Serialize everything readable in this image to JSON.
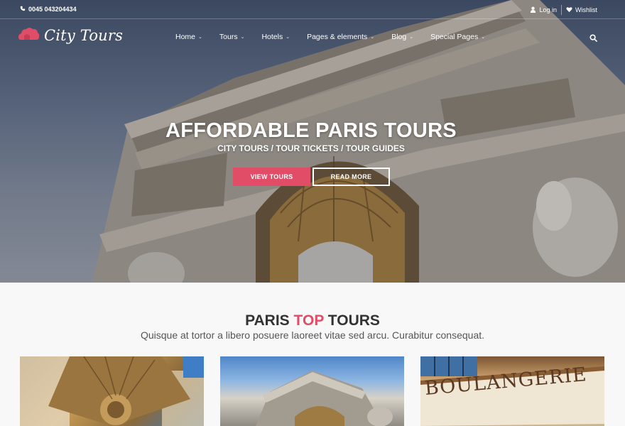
{
  "topbar": {
    "phone": "0045 043204434",
    "login": "Log in",
    "wishlist": "Wishlist"
  },
  "brand": {
    "name": "City Tours",
    "color": "#e14d67"
  },
  "nav": {
    "items": [
      {
        "label": "Home"
      },
      {
        "label": "Tours"
      },
      {
        "label": "Hotels"
      },
      {
        "label": "Pages & elements"
      },
      {
        "label": "Blog"
      },
      {
        "label": "Special Pages"
      }
    ]
  },
  "hero": {
    "title": "AFFORDABLE PARIS TOURS",
    "subtitle": "CITY TOURS / TOUR TICKETS / TOUR GUIDES",
    "primary_button": "VIEW TOURS",
    "secondary_button": "READ MORE"
  },
  "section": {
    "title_pre": "PARIS ",
    "title_accent": "TOP",
    "title_post": " TOURS",
    "subtitle": "Quisque at tortor a libero posuere laoreet vitae sed arcu. Curabitur consequat."
  },
  "cards": {
    "boulangerie_sign": "BOULANGERIE"
  },
  "icons": [
    "phone-icon",
    "user-icon",
    "heart-icon",
    "search-icon",
    "chevron-down-icon",
    "cloud-logo-icon"
  ]
}
